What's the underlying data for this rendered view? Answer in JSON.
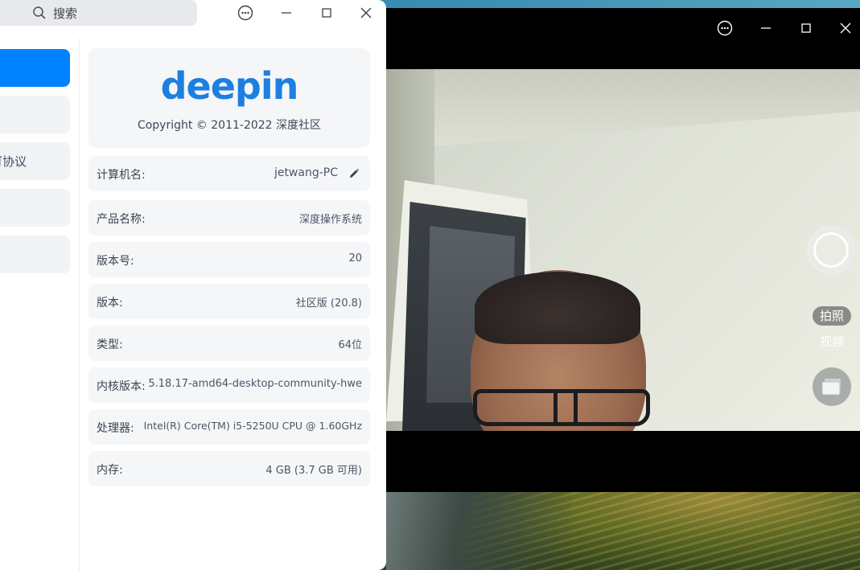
{
  "control_center": {
    "search": {
      "placeholder": "搜索",
      "icon": "search-icon"
    },
    "titlebar": {
      "menu_icon": "more-icon",
      "minimize_icon": "minimize-icon",
      "maximize_icon": "maximize-icon",
      "close_icon": "close-icon"
    },
    "sidebar": {
      "items": [
        {
          "label": "",
          "active": true
        },
        {
          "label": "",
          "active": false
        },
        {
          "label": "可协议",
          "active": false
        },
        {
          "label": "",
          "active": false
        },
        {
          "label": "",
          "active": false
        }
      ]
    },
    "about": {
      "logo_text": "deepin",
      "copyright": "Copyright © 2011-2022 深度社区",
      "rows": [
        {
          "label": "计算机名:",
          "value": "jetwang-PC",
          "editable": true
        },
        {
          "label": "产品名称:",
          "value": "深度操作系统"
        },
        {
          "label": "版本号:",
          "value": "20"
        },
        {
          "label": "版本:",
          "value": "社区版 (20.8)"
        },
        {
          "label": "类型:",
          "value": "64位"
        },
        {
          "label": "内核版本:",
          "value": "5.18.17-amd64-desktop-community-hwe"
        },
        {
          "label": "处理器:",
          "value": "Intel(R) Core(TM) i5-5250U CPU @ 1.60GHz"
        },
        {
          "label": "内存:",
          "value": "4 GB (3.7 GB 可用)"
        }
      ]
    }
  },
  "camera": {
    "titlebar": {
      "menu_icon": "more-icon",
      "minimize_icon": "minimize-icon",
      "maximize_icon": "maximize-icon",
      "close_icon": "close-icon"
    },
    "modes": {
      "photo": "拍照",
      "video": "视频",
      "active": "photo"
    },
    "shutter_icon": "shutter-icon",
    "gallery_icon": "gallery-icon"
  },
  "colors": {
    "accent": "#0081ff",
    "logo": "#1d7fe0"
  }
}
